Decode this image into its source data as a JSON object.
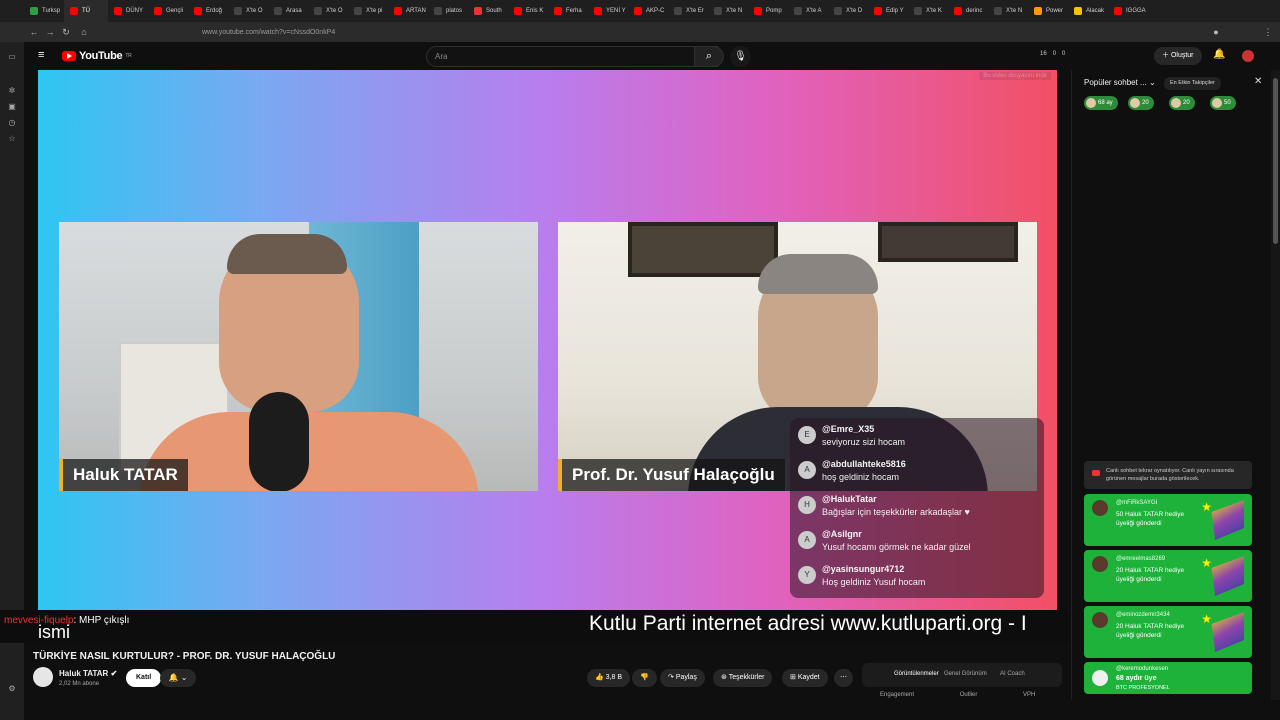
{
  "browser": {
    "tabs": [
      {
        "label": "Turksp",
        "color": "#2ea043"
      },
      {
        "label": "TÜ",
        "color": "#ff0000",
        "active": true
      },
      {
        "label": "DÜNY",
        "color": "#ff0000"
      },
      {
        "label": "Gençli",
        "color": "#ff0000"
      },
      {
        "label": "Erdoğ",
        "color": "#ff0000"
      },
      {
        "label": "X'te O",
        "color": "#444"
      },
      {
        "label": "Arasa",
        "color": "#444"
      },
      {
        "label": "X'te O",
        "color": "#444"
      },
      {
        "label": "X'te pi",
        "color": "#444"
      },
      {
        "label": "ARTAN",
        "color": "#ff0000"
      },
      {
        "label": "platos",
        "color": "#444"
      },
      {
        "label": "South",
        "color": "#e33"
      },
      {
        "label": "Enis K",
        "color": "#ff0000"
      },
      {
        "label": "Ferha",
        "color": "#ff0000"
      },
      {
        "label": "YENİ Y",
        "color": "#ff0000"
      },
      {
        "label": "AKP-C",
        "color": "#ff0000"
      },
      {
        "label": "X'te Er",
        "color": "#444"
      },
      {
        "label": "X'te N",
        "color": "#444"
      },
      {
        "label": "Pomp",
        "color": "#ff0000"
      },
      {
        "label": "X'te A",
        "color": "#444"
      },
      {
        "label": "X'te D",
        "color": "#444"
      },
      {
        "label": "Edip Y",
        "color": "#ff0000"
      },
      {
        "label": "X'te K",
        "color": "#444"
      },
      {
        "label": "derinc",
        "color": "#ff0000"
      },
      {
        "label": "X'te N",
        "color": "#444"
      },
      {
        "label": "Power",
        "color": "#f90"
      },
      {
        "label": "Alacak",
        "color": "#f5c400"
      },
      {
        "label": "IGGGA",
        "color": "#ff0000"
      }
    ],
    "url": "www.youtube.com/watch?v=cNssdO0nkP4"
  },
  "header": {
    "logo_text": "YouTube",
    "logo_sup": "TR",
    "search_placeholder": "Ara",
    "ext_counts": [
      "16",
      "0",
      "0"
    ],
    "create_label": "Oluştur"
  },
  "video": {
    "download_note": "Bu video dosyasını indir",
    "left_name": "Haluk TATAR",
    "right_name": "Prof. Dr. Yusuf Halaçoğlu",
    "chat_overlay": [
      {
        "user": "@Emre_X35",
        "text": "seviyoruz sizi hocam",
        "initial": "E"
      },
      {
        "user": "@abdullahteke5816",
        "text": "hoş geldiniz hocam",
        "initial": "A"
      },
      {
        "user": "@HalukTatar",
        "text": "Bağışlar için teşekkürler arkadaşlar ♥",
        "initial": "H"
      },
      {
        "user": "@Asilgnr",
        "text": "Yusuf hocamı görmek ne kadar güzel",
        "initial": "A"
      },
      {
        "user": "@yasinsungur4712",
        "text": "Hoş geldiniz Yusuf hocam",
        "initial": "Y"
      }
    ],
    "ticker_left_red": "mevvesi-fiquelp",
    "ticker_left": ": MHP çıkışlı",
    "ticker_big": "ismi",
    "ticker_right": "Kutlu Parti internet adresi www.kutluparti.org - I"
  },
  "info": {
    "title": "TÜRKİYE NASIL KURTULUR? - PROF. DR. YUSUF HALAÇOĞLU",
    "channel": "Haluk TATAR",
    "subscribers": "2,02 Mn abone",
    "join_label": "Katıl",
    "likes": "3,8 B",
    "share_label": "Paylaş",
    "thanks_label": "Teşekkürler",
    "save_label": "Kaydet",
    "tabs": [
      "Görüntülenmeler",
      "Genel Görünüm",
      "AI Coach"
    ],
    "sub_tabs": [
      "Engagement",
      "Outlier",
      "VPH"
    ]
  },
  "chat_panel": {
    "header": "Popüler sohbet ...",
    "top_fans": "En Etkin Takipçiler",
    "pills": [
      "68 ay",
      "20",
      "20",
      "50"
    ],
    "replay_note": "Canlı sohbet tekrar oynatılıyor. Canlı yayın sırasında görünen mesajlar burada gösterilecek.",
    "gifts": [
      {
        "user": "@mFiRkSAYGI",
        "text": "50 Haluk TATAR hediye üyeliği gönderdi"
      },
      {
        "user": "@emreelmas8269",
        "text": "20 Haluk TATAR hediye üyeliği gönderdi"
      },
      {
        "user": "@eminozdemir3434",
        "text": "20 Haluk TATAR hediye üyeliği gönderdi"
      }
    ],
    "member": {
      "user": "@keremodunkesen",
      "text": "68 aydır üye",
      "level": "BTC PROFESYONEL"
    }
  }
}
